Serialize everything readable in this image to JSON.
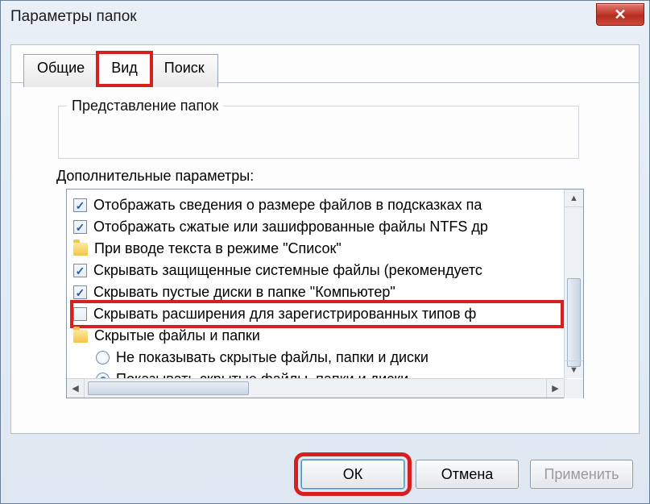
{
  "window": {
    "title": "Параметры папок"
  },
  "tabs": {
    "general": "Общие",
    "view": "Вид",
    "search": "Поиск"
  },
  "groupbox": {
    "folder_views_legend": "Представление папок"
  },
  "advanced": {
    "label": "Дополнительные параметры:",
    "items": [
      {
        "kind": "checkbox",
        "checked": true,
        "text": "Отображать сведения о размере файлов в подсказках па"
      },
      {
        "kind": "checkbox",
        "checked": true,
        "text": "Отображать сжатые или зашифрованные файлы NTFS др"
      },
      {
        "kind": "folder",
        "text": "При вводе текста в режиме \"Список\""
      },
      {
        "kind": "checkbox",
        "checked": true,
        "text": "Скрывать защищенные системные файлы (рекомендуетс"
      },
      {
        "kind": "checkbox",
        "checked": true,
        "text": "Скрывать пустые диски в папке \"Компьютер\""
      },
      {
        "kind": "checkbox",
        "checked": false,
        "text": "Скрывать расширения для зарегистрированных типов ф",
        "highlight": true
      },
      {
        "kind": "folder",
        "text": "Скрытые файлы и папки"
      },
      {
        "kind": "radio",
        "selected": false,
        "text": "Не показывать скрытые файлы, папки и диски",
        "indent": true
      },
      {
        "kind": "radio",
        "selected": true,
        "text": "Показывать скрытые файлы, папки и диски",
        "indent": true
      }
    ]
  },
  "buttons": {
    "ok": "ОК",
    "cancel": "Отмена",
    "apply": "Применить"
  }
}
